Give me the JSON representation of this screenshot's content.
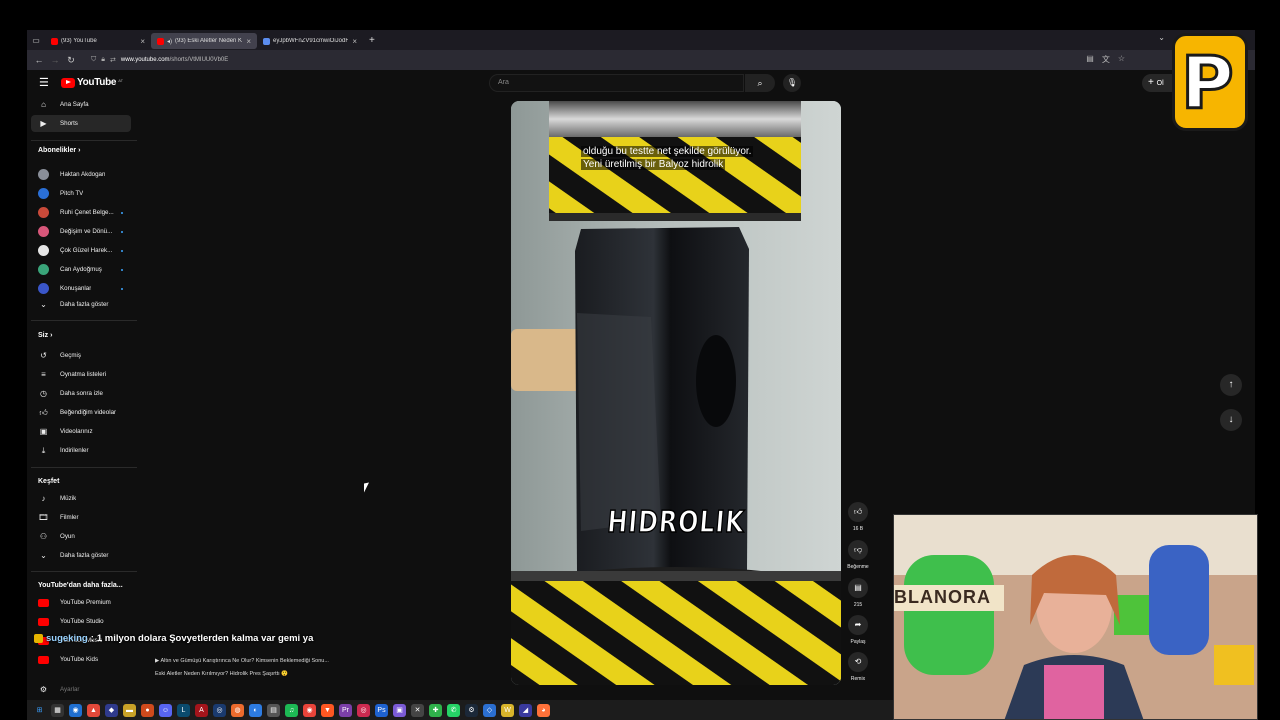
{
  "browser": {
    "tabs": [
      {
        "title": "(93) YouTube",
        "active": false,
        "favicon": "youtube-icon"
      },
      {
        "title": "(93) Eski Aletler Neden Kırıl",
        "active": true,
        "favicon": "youtube-icon"
      },
      {
        "title": "eyJpbWFnZV91cmwiOiJodHRwc",
        "active": false,
        "favicon": "page-icon"
      }
    ],
    "url_prefix": "www.youtube.com",
    "url_path": "/shorts/VtMIUU0Vb0E"
  },
  "youtube": {
    "logo_text": "YouTube",
    "country_code": "AT",
    "search_placeholder": "Ara",
    "create_label": "Ol",
    "sidebar": {
      "main": [
        {
          "label": "Ana Sayfa",
          "icon": "home-icon"
        },
        {
          "label": "Shorts",
          "icon": "shorts-icon",
          "active": true
        }
      ],
      "subscriptions_title": "Abonelikler",
      "subscriptions": [
        {
          "label": "Haktan Akdogan",
          "color": "#8a8f99",
          "dot": false
        },
        {
          "label": "Pitch TV",
          "color": "#2a6fd6",
          "dot": false
        },
        {
          "label": "Ruhi Çenet Belge...",
          "color": "#c94a3a",
          "dot": true
        },
        {
          "label": "Değişim ve Dönü...",
          "color": "#d8577a",
          "dot": true
        },
        {
          "label": "Çok Güzel Harek...",
          "color": "#e6e6e6",
          "dot": true
        },
        {
          "label": "Can Aydoğmuş",
          "color": "#3aa57a",
          "dot": true
        },
        {
          "label": "Konuşanlar",
          "color": "#3a56c9",
          "dot": true
        }
      ],
      "show_more": "Daha fazla göster",
      "you_title": "Siz",
      "you": [
        {
          "label": "Geçmiş",
          "icon": "history-icon"
        },
        {
          "label": "Oynatma listeleri",
          "icon": "playlists-icon"
        },
        {
          "label": "Daha sonra izle",
          "icon": "watch-later-icon"
        },
        {
          "label": "Beğendiğim videolar",
          "icon": "like-icon"
        },
        {
          "label": "Videolarınız",
          "icon": "your-videos-icon"
        },
        {
          "label": "İndirilenler",
          "icon": "download-icon"
        }
      ],
      "explore_title": "Keşfet",
      "explore": [
        {
          "label": "Müzik",
          "icon": "music-icon"
        },
        {
          "label": "Filmler",
          "icon": "film-icon"
        },
        {
          "label": "Oyun",
          "icon": "gaming-icon"
        }
      ],
      "show_more_2": "Daha fazla göster",
      "more_title": "YouTube'dan daha fazla...",
      "more": [
        {
          "label": "YouTube Premium"
        },
        {
          "label": "YouTube Studio"
        },
        {
          "label": "YouTube Music"
        },
        {
          "label": "YouTube Kids"
        }
      ],
      "cut_label": "Ayarlar"
    },
    "short": {
      "caption_line1": "olduğu bu testte net şekilde görülüyor.",
      "caption_line2": "Yeni üretilmiş bir Balyoz hidrolik",
      "overlay_text": "HIDROLIK"
    },
    "actions": {
      "likes": "16 B",
      "dislike_label": "Beğenme",
      "comments": "215",
      "share_label": "Paylaş",
      "remix_label": "Remix"
    }
  },
  "stream": {
    "chat_user": "sugeking",
    "chat_sep": ":",
    "chat_message": "1 milyon dolara Şovyetlerden kalma var gemi ya",
    "pip_title_1": "Altın ve Gümüşü Karıştırınca Ne Olur? Kimsenin Beklemediği Sonu...",
    "pip_title_2": "Eski Aletler Neden Kırılmıyor? Hidrolik Pres Şaşırttı 😲",
    "webcam_sign": "BLANORA",
    "logo_letter": "P"
  },
  "colors": {
    "accent_red": "#ff0000",
    "hazard_yellow": "#e8d21a",
    "badge_yellow": "#f7b500"
  }
}
